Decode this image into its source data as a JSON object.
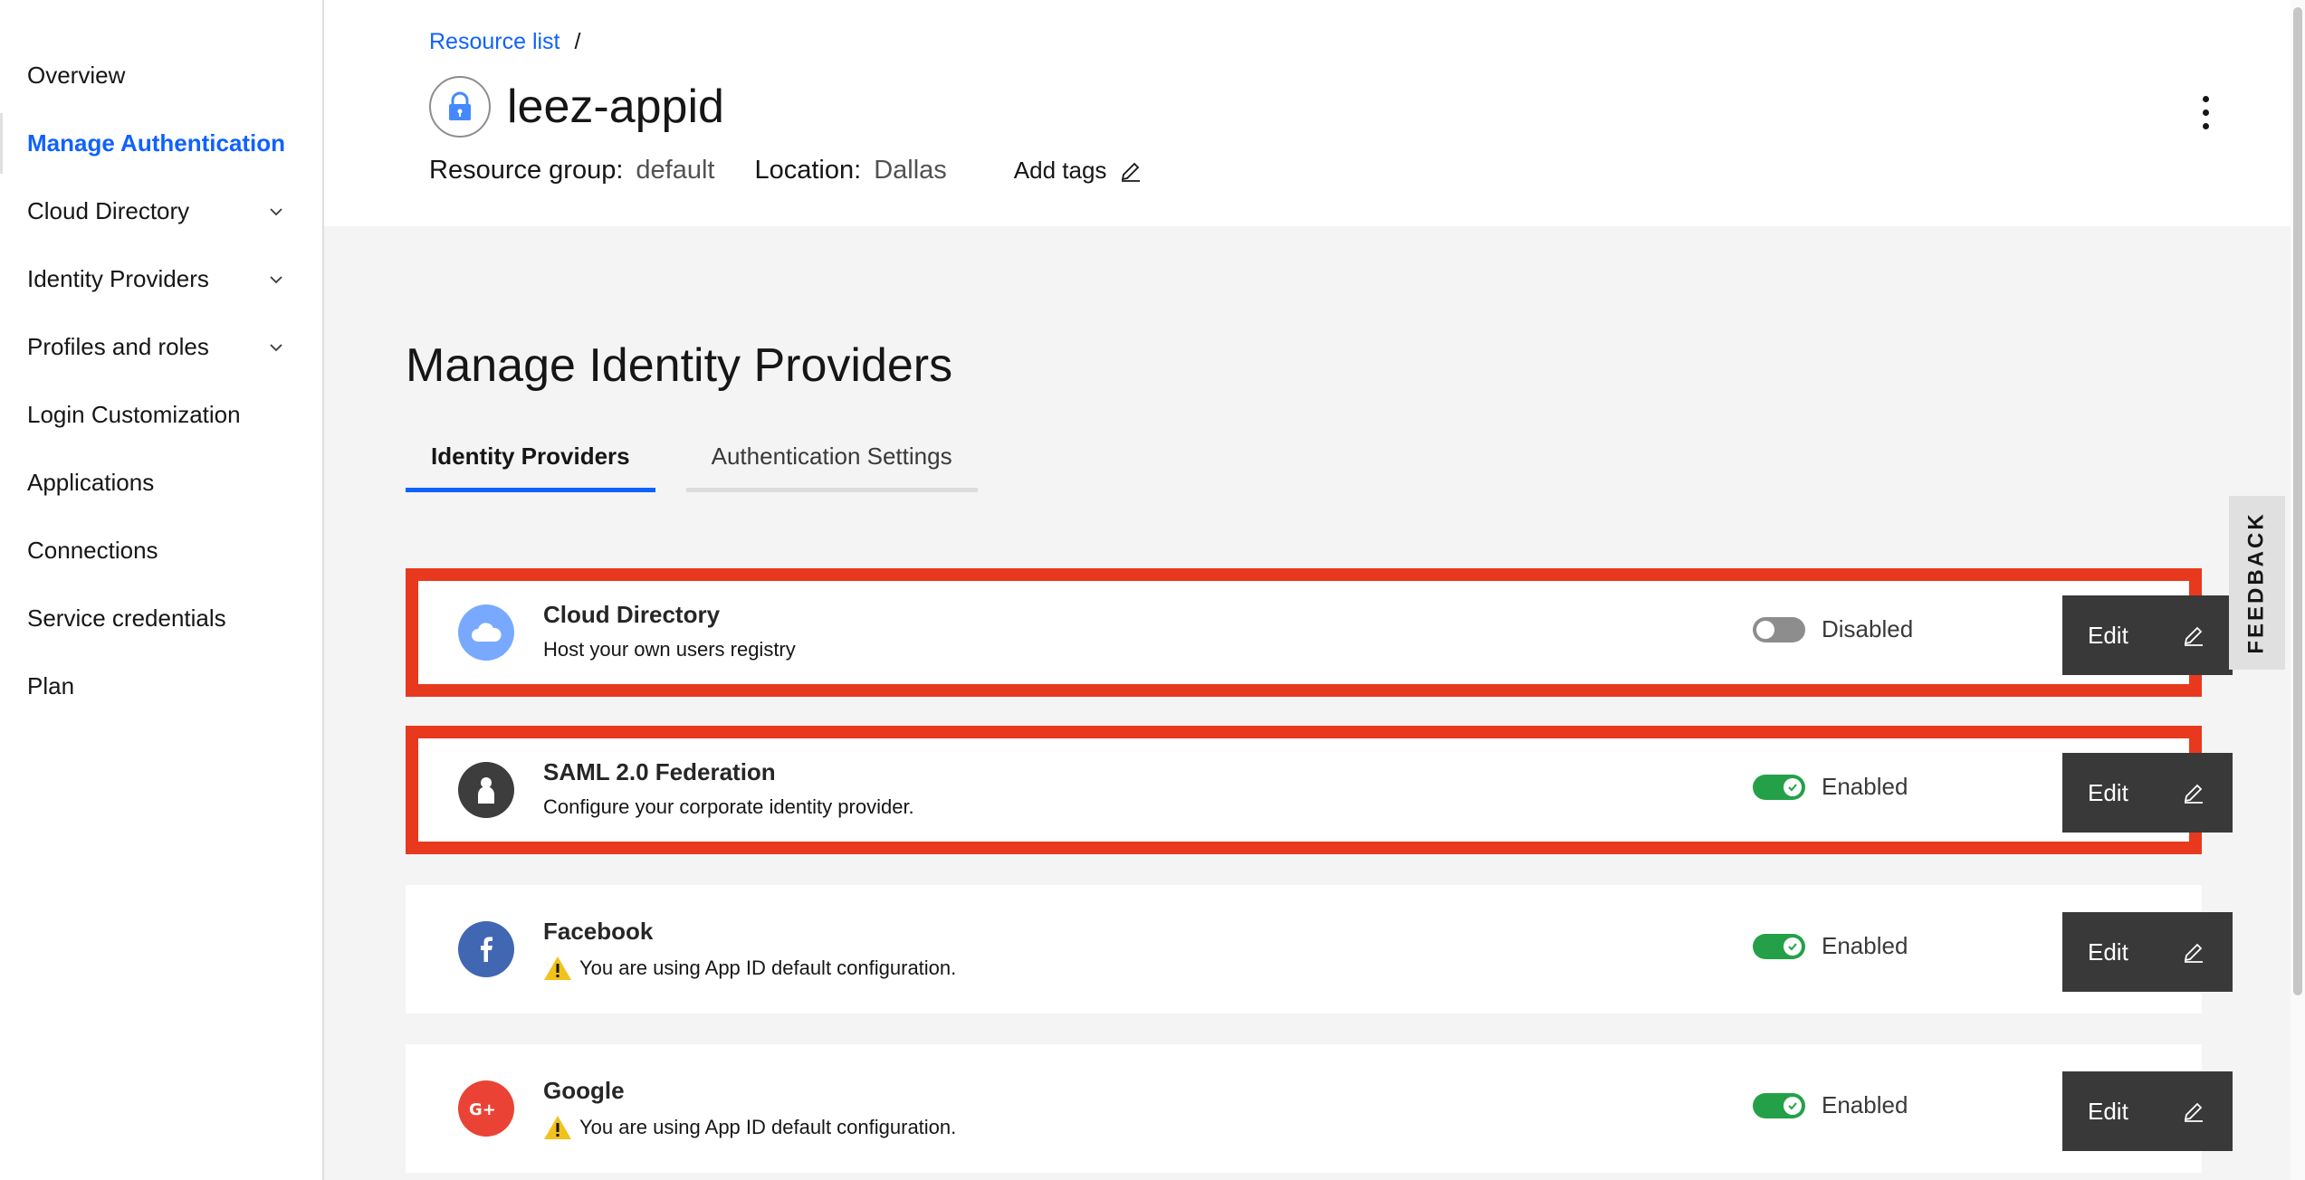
{
  "sidebar": {
    "items": [
      {
        "label": "Overview"
      },
      {
        "label": "Manage Authentication"
      },
      {
        "label": "Cloud Directory"
      },
      {
        "label": "Identity Providers"
      },
      {
        "label": "Profiles and roles"
      },
      {
        "label": "Login Customization"
      },
      {
        "label": "Applications"
      },
      {
        "label": "Connections"
      },
      {
        "label": "Service credentials"
      },
      {
        "label": "Plan"
      }
    ]
  },
  "header": {
    "breadcrumb_link": "Resource list",
    "breadcrumb_sep": "/",
    "title": "leez-appid",
    "resource_group_label": "Resource group:",
    "resource_group_value": "default",
    "location_label": "Location:",
    "location_value": "Dallas",
    "add_tags": "Add tags"
  },
  "main": {
    "title": "Manage Identity Providers",
    "tabs": [
      {
        "label": "Identity Providers"
      },
      {
        "label": "Authentication Settings"
      }
    ],
    "providers": [
      {
        "name": "Cloud Directory",
        "description": "Host your own users registry",
        "status": "Disabled",
        "edit": "Edit",
        "icon": "cloud-icon"
      },
      {
        "name": "SAML 2.0 Federation",
        "description": "Configure your corporate identity provider.",
        "status": "Enabled",
        "edit": "Edit",
        "icon": "person-icon"
      },
      {
        "name": "Facebook",
        "description": "You are using App ID default configuration.",
        "status": "Enabled",
        "edit": "Edit",
        "icon": "facebook-icon"
      },
      {
        "name": "Google",
        "description": "You are using App ID default configuration.",
        "status": "Enabled",
        "edit": "Edit",
        "icon": "google-plus-icon"
      }
    ]
  },
  "feedback": "FEEDBACK",
  "colors": {
    "accent": "#0f62fe",
    "highlight_border": "#e8391f",
    "toggle_on": "#24a148",
    "toggle_off": "#8d8d8d",
    "button": "#393939"
  }
}
